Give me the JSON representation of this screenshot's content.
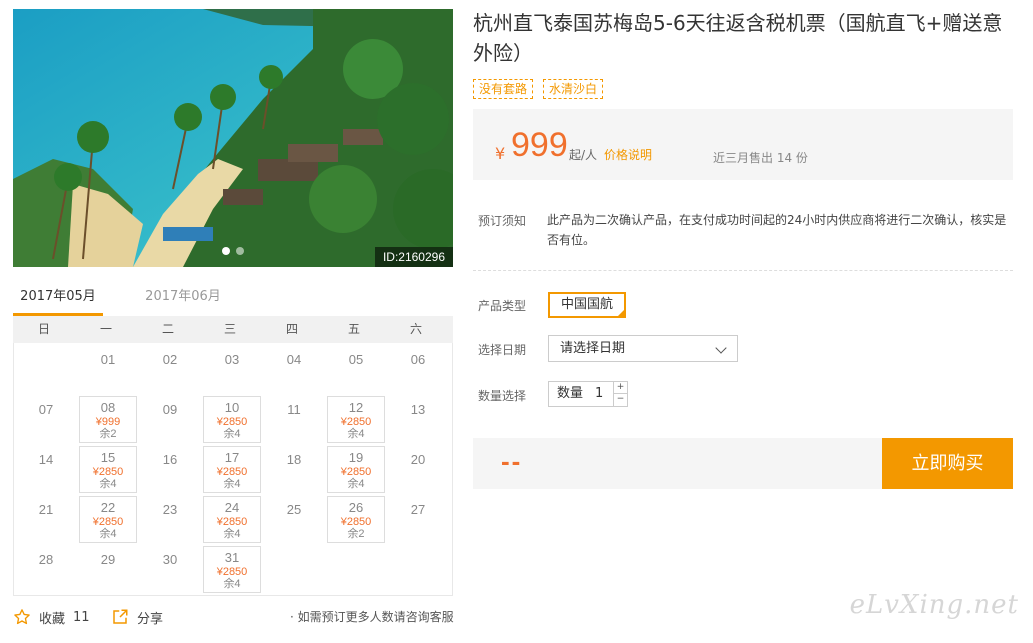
{
  "hero": {
    "id_label": "ID:2160296"
  },
  "calendar": {
    "tabs": [
      {
        "label": "2017年05月"
      },
      {
        "label": "2017年06月"
      }
    ],
    "weekdays": [
      "日",
      "一",
      "二",
      "三",
      "四",
      "五",
      "六"
    ],
    "days": [
      {
        "day": "01"
      },
      {
        "day": "02"
      },
      {
        "day": "03"
      },
      {
        "day": "04"
      },
      {
        "day": "05"
      },
      {
        "day": "06"
      },
      {
        "day": "07"
      },
      {
        "day": "08",
        "price": "¥999",
        "remain": "余2"
      },
      {
        "day": "09"
      },
      {
        "day": "10",
        "price": "¥2850",
        "remain": "余4"
      },
      {
        "day": "11"
      },
      {
        "day": "12",
        "price": "¥2850",
        "remain": "余4"
      },
      {
        "day": "13"
      },
      {
        "day": "14"
      },
      {
        "day": "15",
        "price": "¥2850",
        "remain": "余4"
      },
      {
        "day": "16"
      },
      {
        "day": "17",
        "price": "¥2850",
        "remain": "余4"
      },
      {
        "day": "18"
      },
      {
        "day": "19",
        "price": "¥2850",
        "remain": "余4"
      },
      {
        "day": "20"
      },
      {
        "day": "21"
      },
      {
        "day": "22",
        "price": "¥2850",
        "remain": "余4"
      },
      {
        "day": "23"
      },
      {
        "day": "24",
        "price": "¥2850",
        "remain": "余4"
      },
      {
        "day": "25"
      },
      {
        "day": "26",
        "price": "¥2850",
        "remain": "余2"
      },
      {
        "day": "27"
      },
      {
        "day": "28"
      },
      {
        "day": "29"
      },
      {
        "day": "30"
      },
      {
        "day": "31",
        "price": "¥2850",
        "remain": "余4"
      }
    ]
  },
  "footer": {
    "favorite_label": "收藏",
    "favorite_count": "11",
    "share_label": "分享",
    "note": "· 如需预订更多人数请咨询客服"
  },
  "product": {
    "title": "杭州直飞泰国苏梅岛5-6天往返含税机票（国航直飞+赠送意外险）",
    "tags": [
      "没有套路",
      "水清沙白"
    ],
    "price": {
      "currency": "¥",
      "amount": "999",
      "unit": "起/人",
      "explain_link": "价格说明",
      "sold": "近三月售出 14 份"
    },
    "notice_label": "预订须知",
    "notice_text": "此产品为二次确认产品，在支付成功时间起的24小时内供应商将进行二次确认，核实是否有位。",
    "type_label": "产品类型",
    "type_value": "中国国航",
    "date_label": "选择日期",
    "date_placeholder": "请选择日期",
    "qty_label": "数量选择",
    "qty_prefix": "数量",
    "qty_value": "1",
    "qty_plus": "+",
    "qty_minus": "−",
    "total": "--",
    "buy_label": "立即购买"
  },
  "watermark": "eLvXing.net",
  "colors": {
    "accent": "#f39800",
    "price": "#f0702d"
  }
}
